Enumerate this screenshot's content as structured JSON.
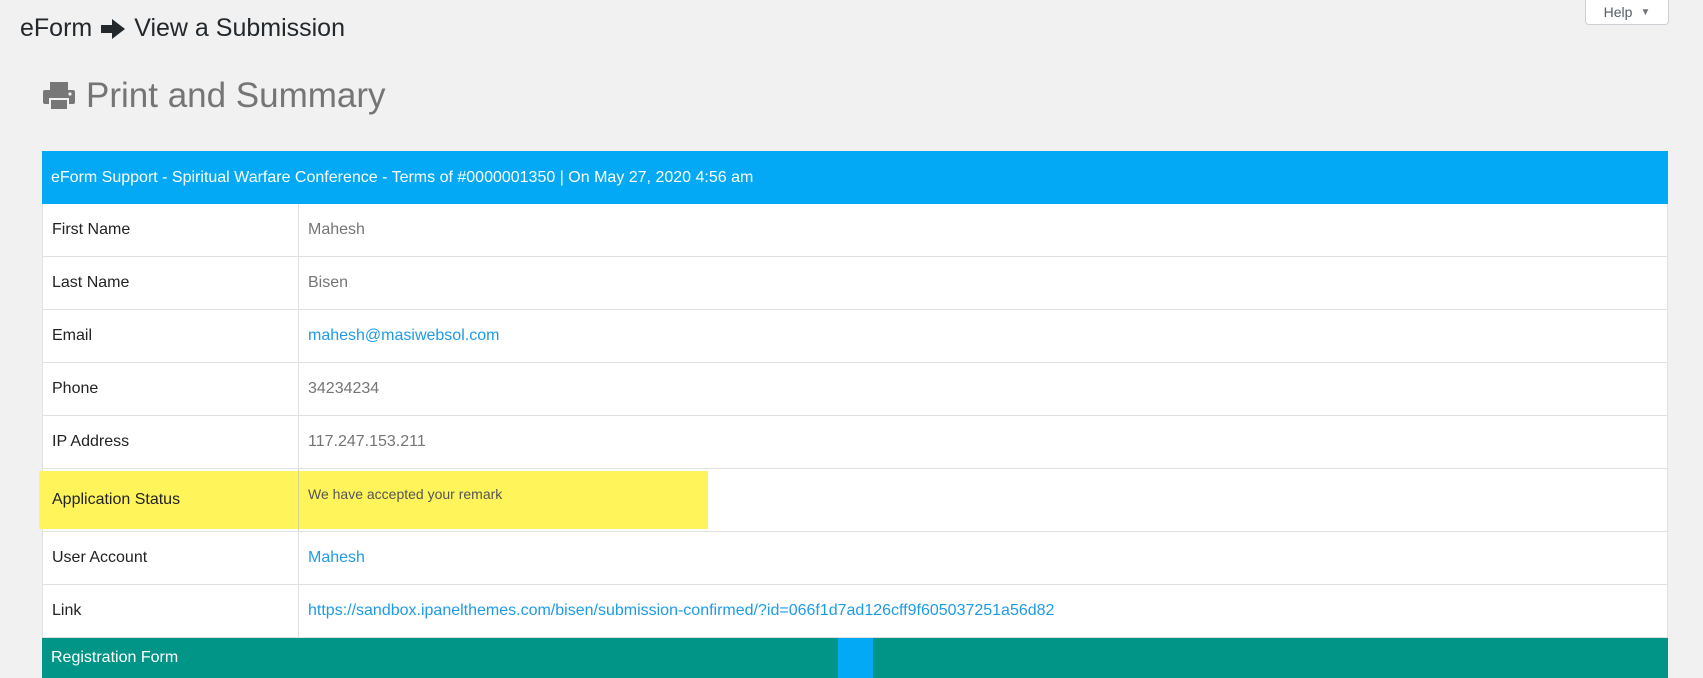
{
  "help": {
    "label": "Help"
  },
  "breadcrumb": {
    "app": "eForm",
    "page": "View a Submission"
  },
  "heading": {
    "title": "Print and Summary"
  },
  "summary": {
    "header": "eForm Support - Spiritual Warfare Conference - Terms of #0000001350 | On May 27, 2020 4:56 am",
    "rows": [
      {
        "label": "First Name",
        "value": "Mahesh"
      },
      {
        "label": "Last Name",
        "value": "Bisen"
      },
      {
        "label": "Email",
        "value": "mahesh@masiwebsol.com"
      },
      {
        "label": "Phone",
        "value": "34234234"
      },
      {
        "label": "IP Address",
        "value": "117.247.153.211"
      },
      {
        "label": "Application Status",
        "value": "We have accepted your remark"
      },
      {
        "label": "User Account",
        "value": "Mahesh"
      },
      {
        "label": "Link",
        "value": "https://sandbox.ipanelthemes.com/bisen/submission-confirmed/?id=066f1d7ad126cff9f605037251a56d82"
      }
    ]
  },
  "section": {
    "title": "Registration Form"
  },
  "colors": {
    "header": "#03a9f4",
    "section": "#009587",
    "highlight": "#fff55a",
    "link": "#1e9be6"
  }
}
